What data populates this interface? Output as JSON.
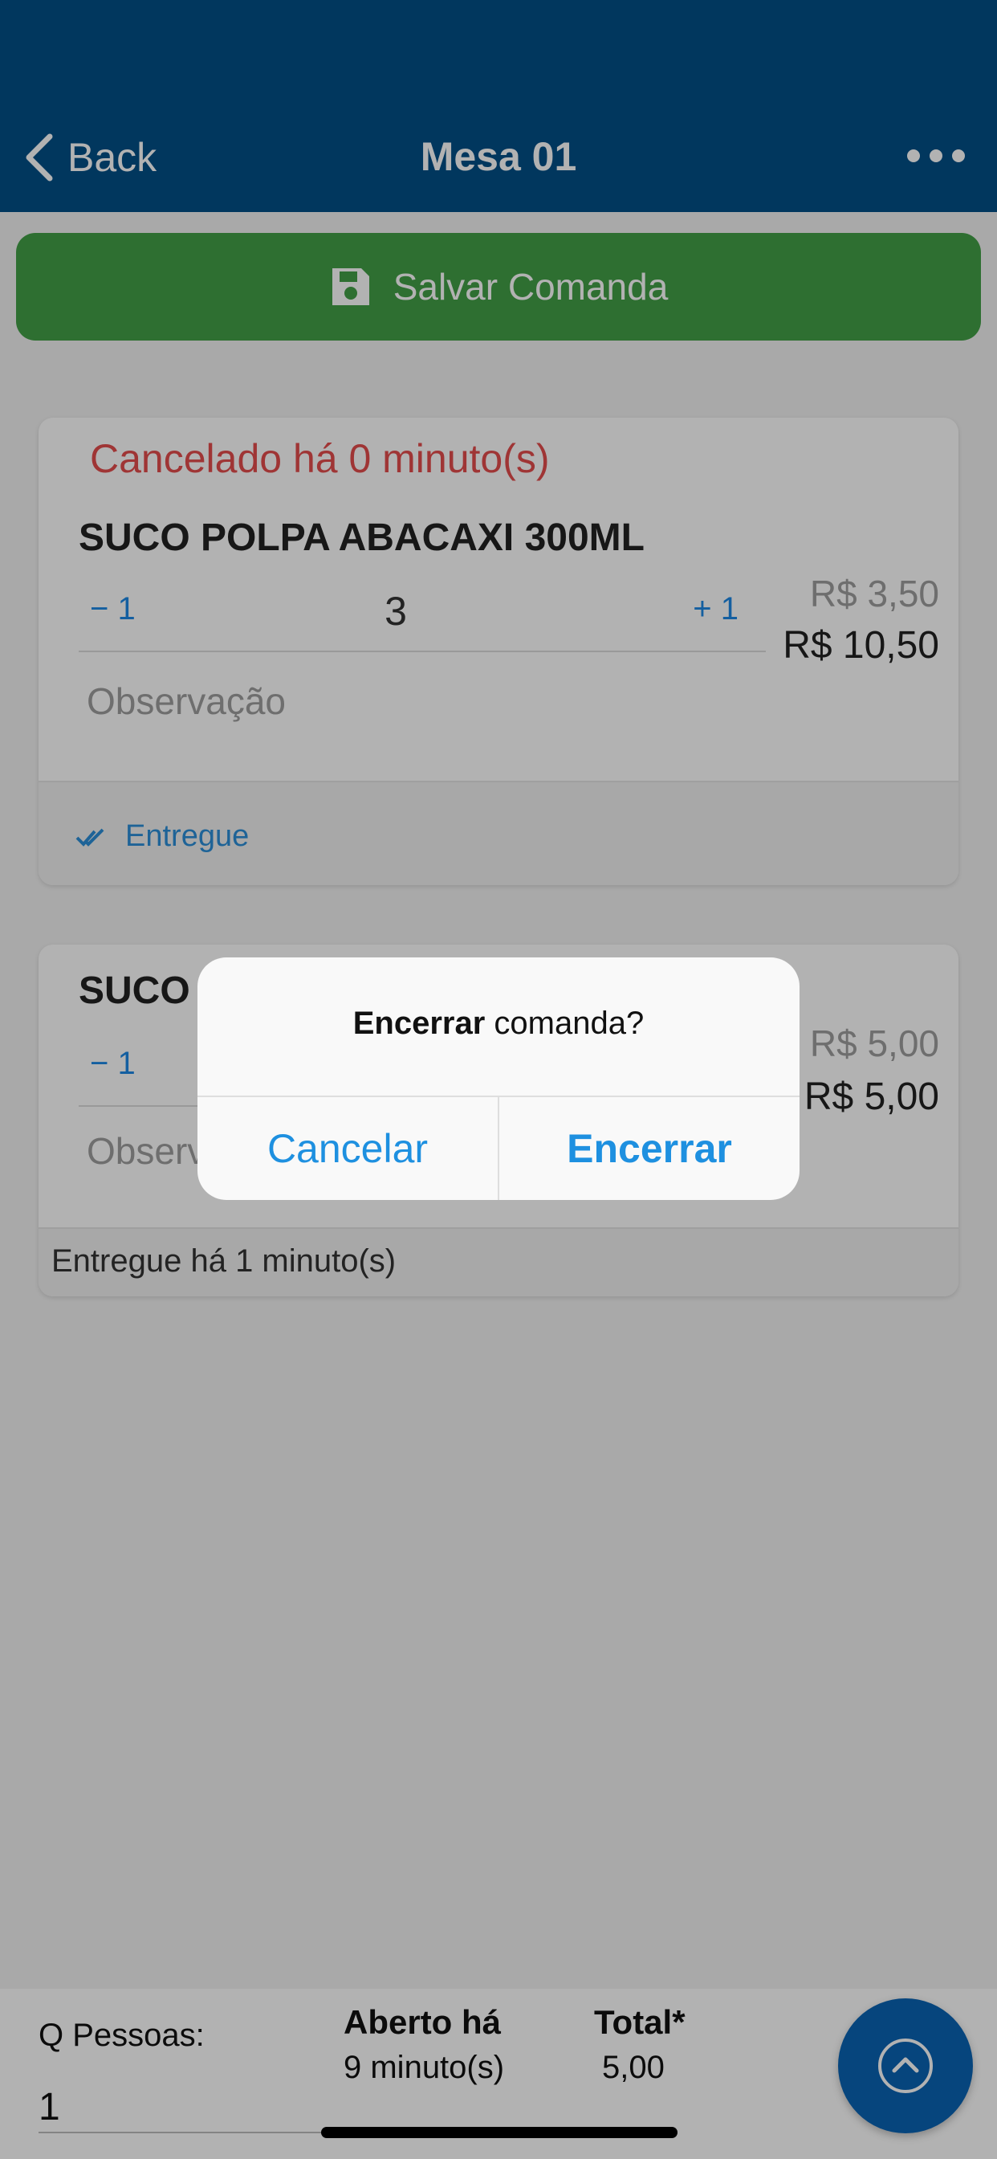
{
  "nav": {
    "back_label": "Back",
    "title": "Mesa 01"
  },
  "save_button": {
    "label": "Salvar Comanda"
  },
  "items": [
    {
      "status": "Cancelado há 0 minuto(s)",
      "name": "SUCO POLPA ABACAXI 300ML",
      "minus_label": "− 1",
      "quantity": "3",
      "plus_label": "+ 1",
      "unit_price": "R$ 3,50",
      "total_price": "R$ 10,50",
      "observation_placeholder": "Observação",
      "footer_action": "Entregue"
    },
    {
      "name": "SUCO",
      "minus_label": "− 1",
      "unit_price": "R$ 5,00",
      "total_price": "R$ 5,00",
      "observation_placeholder": "Observ",
      "footer_status": "Entregue há 1 minuto(s)"
    }
  ],
  "bottom_bar": {
    "people_label": "Q Pessoas:",
    "people_value": "1",
    "open_label": "Aberto há",
    "open_value": "9 minuto(s)",
    "total_label": "Total*",
    "total_value": "5,00"
  },
  "dialog": {
    "message_bold": "Encerrar",
    "message_rest": " comanda?",
    "cancel_label": "Cancelar",
    "confirm_label": "Encerrar"
  },
  "icons": {
    "back": "chevron-left-icon",
    "more": "ellipsis-icon",
    "save": "floppy-disk-icon",
    "delivered": "double-check-icon",
    "fab": "chevron-up-circle-icon"
  },
  "colors": {
    "navbar": "#024f87",
    "save_button": "#43a047",
    "cancel_status": "#e44d4d",
    "accent": "#1e88e5",
    "fab": "#0a63b4"
  }
}
